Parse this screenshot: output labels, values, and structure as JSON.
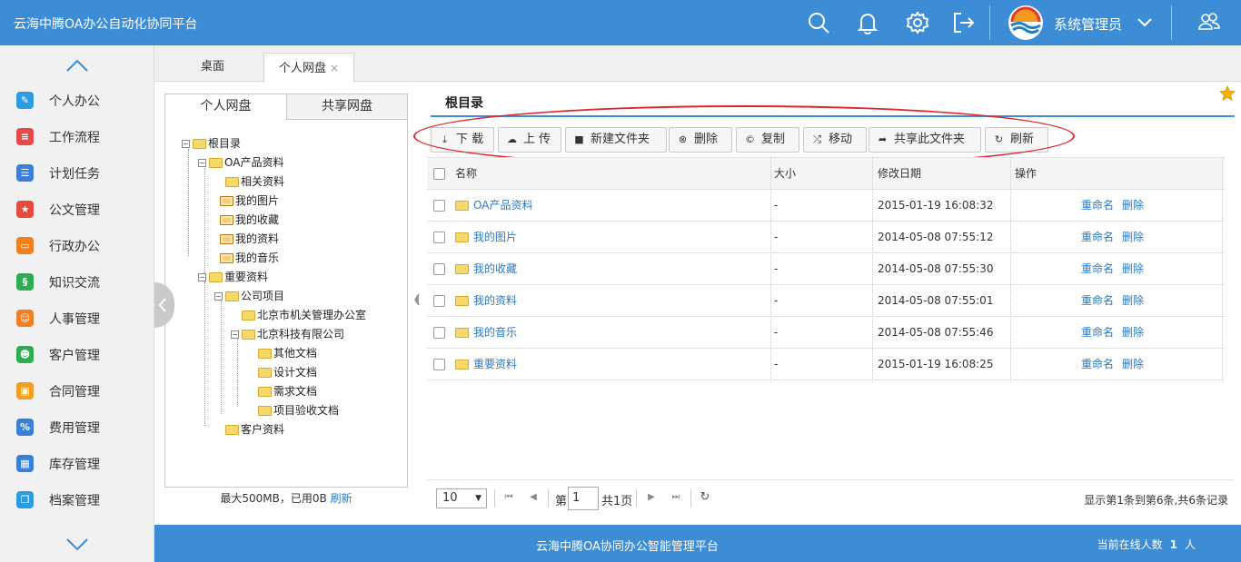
{
  "header": {
    "app_title": "云海中腾OA办公自动化协同平台",
    "user_name": "系统管理员",
    "icons": [
      "search-icon",
      "bell-icon",
      "gear-icon",
      "logout-icon",
      "chevron-down-icon",
      "users-icon"
    ]
  },
  "sidebar": {
    "items": [
      {
        "label": "个人办公",
        "color": "#2d9be0",
        "icon": "edit-icon"
      },
      {
        "label": "工作流程",
        "color": "#e54a4a",
        "icon": "flow-icon"
      },
      {
        "label": "计划任务",
        "color": "#3b7fd9",
        "icon": "list-icon"
      },
      {
        "label": "公文管理",
        "color": "#e64a3b",
        "icon": "star-badge-icon"
      },
      {
        "label": "行政办公",
        "color": "#f08020",
        "icon": "folder-open-icon"
      },
      {
        "label": "知识交流",
        "color": "#2dac52",
        "icon": "link-icon"
      },
      {
        "label": "人事管理",
        "color": "#f08020",
        "icon": "person-icon"
      },
      {
        "label": "客户管理",
        "color": "#2dac52",
        "icon": "people-icon"
      },
      {
        "label": "合同管理",
        "color": "#f0a020",
        "icon": "contract-icon"
      },
      {
        "label": "费用管理",
        "color": "#3b7fd9",
        "icon": "percent-icon"
      },
      {
        "label": "库存管理",
        "color": "#3b7fd9",
        "icon": "grid-icon"
      },
      {
        "label": "档案管理",
        "color": "#2d9be0",
        "icon": "copy-icon"
      }
    ]
  },
  "tabs": {
    "desk": "桌面",
    "active": "个人网盘",
    "close": "×"
  },
  "tree": {
    "tab_personal": "个人网盘",
    "tab_shared": "共享网盘",
    "nodes": [
      {
        "label": "根目录",
        "exp": "⊟"
      },
      {
        "label": "OA产品资料",
        "exp": "⊟"
      },
      {
        "label": "相关资料",
        "exp": ""
      },
      {
        "label": "我的图片",
        "exp": ""
      },
      {
        "label": "我的收藏",
        "exp": ""
      },
      {
        "label": "我的资料",
        "exp": ""
      },
      {
        "label": "我的音乐",
        "exp": ""
      },
      {
        "label": "重要资料",
        "exp": "⊟"
      },
      {
        "label": "公司项目",
        "exp": "⊟"
      },
      {
        "label": "北京市机关管理办公室",
        "exp": ""
      },
      {
        "label": "北京科技有限公司",
        "exp": "⊟"
      },
      {
        "label": "其他文档",
        "exp": ""
      },
      {
        "label": "设计文档",
        "exp": ""
      },
      {
        "label": "需求文档",
        "exp": ""
      },
      {
        "label": "项目验收文档",
        "exp": ""
      },
      {
        "label": "客户资料",
        "exp": ""
      }
    ],
    "quota": "最大500MB，已用0B",
    "refresh": "刷新"
  },
  "main": {
    "breadcrumb": "根目录",
    "toolbar": [
      {
        "label": "下 载",
        "icon": "download-icon"
      },
      {
        "label": "上 传",
        "icon": "upload-icon"
      },
      {
        "label": "新建文件夹",
        "icon": "folder-icon"
      },
      {
        "label": "删除",
        "icon": "delete-icon"
      },
      {
        "label": "复制",
        "icon": "copy-icon"
      },
      {
        "label": "移动",
        "icon": "shuffle-icon"
      },
      {
        "label": "共享此文件夹",
        "icon": "share-icon"
      },
      {
        "label": "刷新",
        "icon": "refresh-icon"
      }
    ],
    "columns": {
      "name": "名称",
      "size": "大小",
      "date": "修改日期",
      "ops": "操作"
    },
    "rows": [
      {
        "name": "OA产品资料",
        "size": "-",
        "date": "2015-01-19 16:08:32"
      },
      {
        "name": "我的图片",
        "size": "-",
        "date": "2014-05-08 07:55:12"
      },
      {
        "name": "我的收藏",
        "size": "-",
        "date": "2014-05-08 07:55:30"
      },
      {
        "name": "我的资料",
        "size": "-",
        "date": "2014-05-08 07:55:01"
      },
      {
        "name": "我的音乐",
        "size": "-",
        "date": "2014-05-08 07:55:46"
      },
      {
        "name": "重要资料",
        "size": "-",
        "date": "2015-01-19 16:08:25"
      }
    ],
    "op_rename": "重命名",
    "op_delete": "删除"
  },
  "pager": {
    "page_size": "10",
    "page_prefix": "第",
    "page_value": "1",
    "page_total": "共1页",
    "record_info": "显示第1条到第6条,共6条记录"
  },
  "footer": {
    "title": "云海中腾OA协同办公智能管理平台",
    "online_label": "当前在线人数",
    "online_count": "1",
    "online_unit": "人"
  }
}
